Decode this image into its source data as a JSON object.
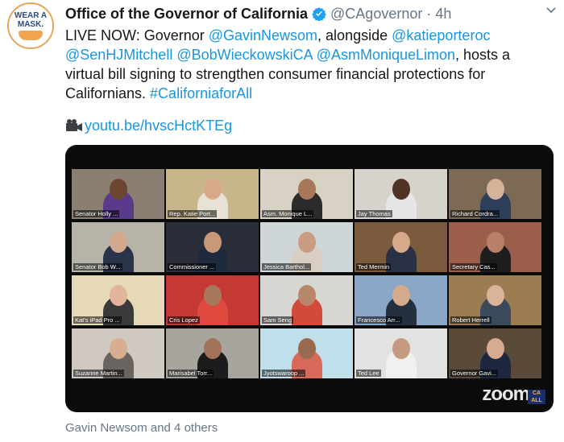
{
  "avatar": {
    "line1": "WEAR A",
    "line2": "MASK."
  },
  "header": {
    "name": "Office of the Governor of California",
    "handle": "@CAgovernor",
    "separator": "·",
    "time": "4h"
  },
  "tweet": {
    "segments": [
      {
        "t": "text",
        "v": "LIVE NOW: Governor "
      },
      {
        "t": "link",
        "v": "@GavinNewsom"
      },
      {
        "t": "text",
        "v": ", alongside "
      },
      {
        "t": "link",
        "v": "@katieporteroc"
      },
      {
        "t": "text",
        "v": " "
      },
      {
        "t": "link",
        "v": "@SenHJMitchell"
      },
      {
        "t": "text",
        "v": " "
      },
      {
        "t": "link",
        "v": "@BobWieckowskiCA"
      },
      {
        "t": "text",
        "v": " "
      },
      {
        "t": "link",
        "v": "@AsmMoniqueLimon"
      },
      {
        "t": "text",
        "v": ", hosts a virtual bill signing to strengthen consumer financial protections for Californians. "
      },
      {
        "t": "link",
        "v": "#CaliforniaforAll"
      }
    ],
    "url_text": "youtu.be/hvscHctKTEg"
  },
  "video": {
    "tiles": [
      {
        "label": "Senator Holly ...",
        "bg": "#8b7f72",
        "skin": "#6b4631",
        "shirt": "#5a3a8a"
      },
      {
        "label": "Rep. Katie Port...",
        "bg": "#c9b58a",
        "skin": "#d9a88a",
        "shirt": "#e8e2d6"
      },
      {
        "label": "Asm. Monique L...",
        "bg": "#d8d2c4",
        "skin": "#a8785a",
        "shirt": "#2b2b2b"
      },
      {
        "label": "Jay Thomas",
        "bg": "#d6d2cc",
        "skin": "#4f3426",
        "shirt": "#e6e6e6"
      },
      {
        "label": "Richard Cordra...",
        "bg": "#7d6a55",
        "skin": "#d7b29a",
        "shirt": "#2f3e58"
      },
      {
        "label": "Senator Bob W...",
        "bg": "#b8b3a8",
        "skin": "#d2a98e",
        "shirt": "#29344a"
      },
      {
        "label": "Commissioner ...",
        "bg": "#2a2e38",
        "skin": "#c89878",
        "shirt": "#1f2a3c"
      },
      {
        "label": "Jessica Barthol...",
        "bg": "#cfd6d8",
        "skin": "#c99b82",
        "shirt": "#d8cfc2"
      },
      {
        "label": "Ted Mermin",
        "bg": "#7b5a3e",
        "skin": "#d6a98a",
        "shirt": "#2a3144"
      },
      {
        "label": "Secretary Cas...",
        "bg": "#9a5e4a",
        "skin": "#b88066",
        "shirt": "#1e1e1e"
      },
      {
        "label": "Kat's iPad Pro ...",
        "bg": "#e6d9b8",
        "skin": "#e0b59a",
        "shirt": "#3a3a3a"
      },
      {
        "label": "Cris Lopez",
        "bg": "#c43a32",
        "skin": "#a8775e",
        "shirt": "#e04a3e"
      },
      {
        "label": "Sam Seng",
        "bg": "#d8d6d2",
        "skin": "#b8876a",
        "shirt": "#d24a3a"
      },
      {
        "label": "Francesco Arr...",
        "bg": "#8aa7c8",
        "skin": "#d4aa8c",
        "shirt": "#22303f"
      },
      {
        "label": "Robert Herrell",
        "bg": "#9c7d52",
        "skin": "#d9b39a",
        "shirt": "#3b4a5a"
      },
      {
        "label": "Suzanne Martin...",
        "bg": "#cfc9c2",
        "skin": "#d8ad92",
        "shirt": "#6a6460"
      },
      {
        "label": "Marisabel Torr...",
        "bg": "#a8a49e",
        "skin": "#a47258",
        "shirt": "#1c1c1c"
      },
      {
        "label": "Jyotswaroop ...",
        "bg": "#bfe0ea",
        "skin": "#9a6a50",
        "shirt": "#d86a5a"
      },
      {
        "label": "Ted Lee",
        "bg": "#e2e2e0",
        "skin": "#c69a80",
        "shirt": "#f0f0f0"
      },
      {
        "label": "Governor Gavi...",
        "bg": "#5a4a3a",
        "skin": "#d6ab90",
        "shirt": "#1d2840"
      }
    ],
    "zoom_text": "zoom",
    "badge_text": "CA ALL"
  },
  "footer": {
    "tagged": "Gavin Newsom and 4 others"
  }
}
